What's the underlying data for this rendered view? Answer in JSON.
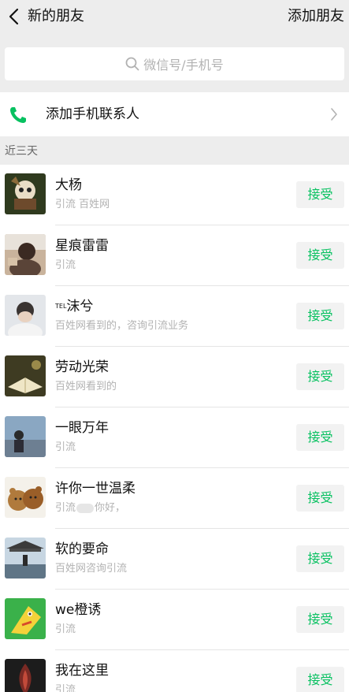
{
  "nav": {
    "back_icon": "back-arrow-icon",
    "title": "新的朋友",
    "action": "添加朋友"
  },
  "search": {
    "placeholder": "微信号/手机号",
    "icon": "search-icon"
  },
  "add_contacts": {
    "icon": "phone-icon",
    "label": "添加手机联系人",
    "chevron": "chevron-right-icon"
  },
  "section_label": "近三天",
  "accept_color": "#07c160",
  "requests": [
    {
      "name": "大杨",
      "message": "引流 百姓网",
      "button": "接受"
    },
    {
      "name": "星痕雷雷",
      "message": "引流",
      "button": "接受"
    },
    {
      "name": "沫兮",
      "name_prefix": "TEL",
      "message": "百姓网看到的，咨询引流业务",
      "button": "接受"
    },
    {
      "name": "劳动光荣",
      "message": "百姓网看到的",
      "button": "接受"
    },
    {
      "name": "一眼万年",
      "message": "引流",
      "button": "接受"
    },
    {
      "name": "许你一世温柔",
      "message_before": "引流",
      "message_after": "你好，",
      "button": "接受"
    },
    {
      "name": "软的要命",
      "message": "百姓网咨询引流",
      "button": "接受"
    },
    {
      "name": "we橙诱",
      "message": "引流",
      "button": "接受"
    },
    {
      "name": "我在这里",
      "message": "引流",
      "button": "接受"
    }
  ]
}
